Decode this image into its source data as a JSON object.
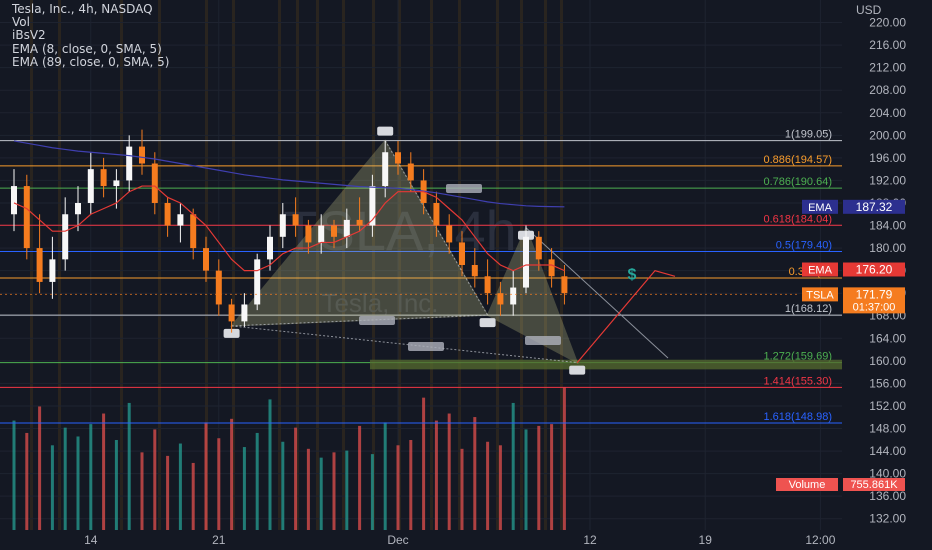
{
  "chart_data": {
    "type": "candlestick",
    "title": "Tesla, Inc., 4h, NASDAQ",
    "legend": [
      "Tesla, Inc., 4h, NASDAQ",
      "Vol",
      "iBsV2",
      "EMA (8, close, 0, SMA, 5)",
      "EMA (89, close, 0, SMA, 5)"
    ],
    "watermark": "TSLA, 4h",
    "watermark_sub": "Tesla, Inc.",
    "currency": "USD",
    "ylim": [
      130,
      224
    ],
    "y_ticks": [
      "132.00",
      "136.00",
      "140.00",
      "144.00",
      "148.00",
      "152.00",
      "156.00",
      "160.00",
      "164.00",
      "168.00",
      "172.00",
      "176.00",
      "180.00",
      "184.00",
      "188.00",
      "192.00",
      "196.00",
      "200.00",
      "204.00",
      "208.00",
      "212.00",
      "216.00",
      "220.00"
    ],
    "x_ticks": [
      {
        "label": "14",
        "i": 6
      },
      {
        "label": "21",
        "i": 16
      },
      {
        "label": "Dec",
        "i": 30
      },
      {
        "label": "12",
        "i": 45
      },
      {
        "label": "19",
        "i": 54
      },
      {
        "label": "12:00",
        "i": 63
      }
    ],
    "candles": [
      [
        186,
        194,
        183,
        191
      ],
      [
        191,
        193,
        178,
        180
      ],
      [
        180,
        186,
        172,
        174
      ],
      [
        174,
        182,
        171,
        178
      ],
      [
        178,
        189,
        176,
        186
      ],
      [
        186,
        191,
        183,
        188
      ],
      [
        188,
        197,
        186,
        194
      ],
      [
        194,
        196,
        189,
        191
      ],
      [
        191,
        194,
        187,
        192
      ],
      [
        192,
        200,
        190,
        198
      ],
      [
        198,
        201,
        193,
        195
      ],
      [
        195,
        197,
        186,
        188
      ],
      [
        188,
        189,
        182,
        184
      ],
      [
        184,
        188,
        181,
        186
      ],
      [
        186,
        187,
        178,
        180
      ],
      [
        180,
        182,
        174,
        176
      ],
      [
        176,
        178,
        168,
        170
      ],
      [
        170,
        171,
        165,
        167
      ],
      [
        167,
        172,
        166,
        170
      ],
      [
        170,
        179,
        169,
        178
      ],
      [
        178,
        184,
        176,
        182
      ],
      [
        182,
        188,
        180,
        186
      ],
      [
        186,
        189,
        182,
        184
      ],
      [
        184,
        185,
        179,
        181
      ],
      [
        181,
        186,
        179,
        184
      ],
      [
        184,
        185,
        180,
        182
      ],
      [
        182,
        187,
        180,
        185
      ],
      [
        185,
        189,
        183,
        184
      ],
      [
        184,
        193,
        182,
        191
      ],
      [
        191,
        199,
        189,
        197
      ],
      [
        197,
        199,
        193,
        195
      ],
      [
        195,
        197,
        190,
        192
      ],
      [
        192,
        194,
        186,
        188
      ],
      [
        188,
        190,
        182,
        184
      ],
      [
        184,
        186,
        179,
        181
      ],
      [
        181,
        183,
        175,
        177
      ],
      [
        177,
        180,
        173,
        175
      ],
      [
        175,
        178,
        170,
        172
      ],
      [
        172,
        174,
        168,
        170
      ],
      [
        170,
        176,
        168,
        173
      ],
      [
        173,
        184,
        172,
        182
      ],
      [
        182,
        183,
        176,
        178
      ],
      [
        178,
        180,
        173,
        175
      ],
      [
        175,
        177,
        170,
        172
      ]
    ],
    "volume": [
      62,
      55,
      70,
      48,
      58,
      53,
      60,
      66,
      51,
      72,
      44,
      57,
      42,
      49,
      38,
      61,
      52,
      63,
      47,
      55,
      74,
      50,
      58,
      46,
      41,
      44,
      45,
      59,
      43,
      61,
      48,
      51,
      75,
      62,
      66,
      46,
      64,
      50,
      48,
      72,
      57,
      59,
      60,
      81
    ],
    "ema8": [
      188,
      187,
      185,
      183,
      183,
      184,
      186,
      187,
      188,
      190,
      191,
      191,
      189,
      188,
      186,
      184,
      181,
      178,
      176,
      176,
      177,
      179,
      180,
      180,
      181,
      181,
      182,
      183,
      185,
      188,
      190,
      190,
      190,
      189,
      187,
      185,
      182,
      179,
      177,
      176,
      177,
      177,
      177,
      176
    ],
    "ema89": [
      199,
      198.6,
      198.2,
      197.8,
      197.5,
      197.2,
      197,
      196.8,
      196.6,
      196.4,
      196.1,
      195.8,
      195.4,
      195,
      194.6,
      194.2,
      193.8,
      193.4,
      193,
      192.7,
      192.4,
      192.1,
      191.9,
      191.7,
      191.5,
      191.3,
      191.1,
      190.9,
      190.8,
      190.7,
      190.6,
      190.4,
      190.1,
      189.8,
      189.4,
      189,
      188.6,
      188.2,
      187.9,
      187.7,
      187.5,
      187.4,
      187.35,
      187.32
    ],
    "fib_levels": [
      {
        "label": "1(199.05)",
        "value": 199.05,
        "color": "#c0c4cc"
      },
      {
        "label": "0.886(194.57)",
        "value": 194.57,
        "color": "#f89c2c"
      },
      {
        "label": "0.786(190.64)",
        "value": 190.64,
        "color": "#4caf50"
      },
      {
        "label": "0.618(184.04)",
        "value": 184.04,
        "color": "#f23645"
      },
      {
        "label": "0.5(179.40)",
        "value": 179.4,
        "color": "#2962ff"
      },
      {
        "label": "0.382(17",
        "value": 174.7,
        "color": "#f89c2c"
      },
      {
        "label": "1(168.12)",
        "value": 168.12,
        "color": "#c0c4cc"
      },
      {
        "label": "1.272(159.69)",
        "value": 159.69,
        "color": "#4caf50"
      },
      {
        "label": "1.414(155.30)",
        "value": 155.3,
        "color": "#f23645"
      },
      {
        "label": "1.618(148.98)",
        "value": 148.98,
        "color": "#2962ff"
      }
    ],
    "pattern_points": [
      {
        "i": 17,
        "v": 166.2
      },
      {
        "i": 29,
        "v": 199.05
      },
      {
        "i": 37,
        "v": 168.12
      },
      {
        "i": 40,
        "v": 183.6
      },
      {
        "i": 44,
        "v": 159.69
      }
    ],
    "price_tags": {
      "ema89": {
        "label": "EMA",
        "value": "187.32",
        "num": 187.32
      },
      "ema8": {
        "label": "EMA",
        "value": "176.20",
        "num": 176.2
      },
      "last": {
        "label": "TSLA",
        "value": "171.79",
        "countdown": "01:37:00",
        "num": 171.79
      },
      "volume": {
        "label": "Volume",
        "value": "755.861K"
      }
    },
    "dollar_sign": "$",
    "colors": {
      "up": "#f7f7f7",
      "down": "#f57c1f",
      "ema8": "#e53935",
      "ema89": "#3f3fb0",
      "vol_up": "#26a69a",
      "vol_down": "#ef5350",
      "pattern": "#c9c98a",
      "background": "#141823"
    }
  }
}
